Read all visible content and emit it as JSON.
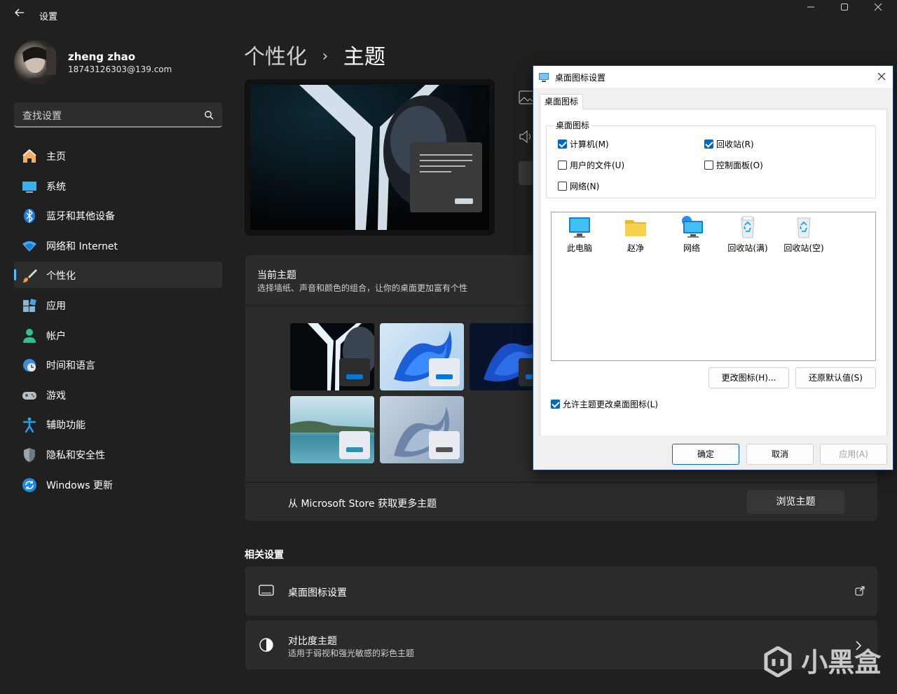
{
  "window": {
    "title": "设置",
    "back_icon": "arrow-left-icon",
    "controls": [
      "minimize-icon",
      "maximize-icon",
      "close-icon"
    ]
  },
  "profile": {
    "name": "zheng zhao",
    "email": "18743126303@139.com"
  },
  "search": {
    "placeholder": "查找设置"
  },
  "sidebar": {
    "items": [
      {
        "label": "主页",
        "icon": "home-icon"
      },
      {
        "label": "系统",
        "icon": "monitor-icon"
      },
      {
        "label": "蓝牙和其他设备",
        "icon": "bluetooth-icon"
      },
      {
        "label": "网络和 Internet",
        "icon": "wifi-icon"
      },
      {
        "label": "个性化",
        "icon": "paintbrush-icon",
        "active": true
      },
      {
        "label": "应用",
        "icon": "apps-icon"
      },
      {
        "label": "帐户",
        "icon": "user-icon"
      },
      {
        "label": "时间和语言",
        "icon": "clock-globe-icon"
      },
      {
        "label": "游戏",
        "icon": "gamepad-icon"
      },
      {
        "label": "辅助功能",
        "icon": "accessibility-icon"
      },
      {
        "label": "隐私和安全性",
        "icon": "shield-icon"
      },
      {
        "label": "Windows 更新",
        "icon": "update-icon"
      }
    ]
  },
  "breadcrumb": {
    "parent": "个性化",
    "separator": "›",
    "current": "主题"
  },
  "current_theme": {
    "title": "当前主题",
    "subtitle": "选择墙纸、声音和颜色的组合，让你的桌面更加富有个性"
  },
  "store": {
    "label": "从 Microsoft Store 获取更多主题",
    "button": "浏览主题"
  },
  "related": {
    "title": "相关设置",
    "items": [
      {
        "label": "桌面图标设置",
        "icon": "desktop-icon",
        "action_icon": "open-external-icon"
      },
      {
        "label": "对比度主题",
        "sub": "适用于弱视和强光敏感的彩色主题",
        "icon": "contrast-icon",
        "action_icon": "chevron-right-icon"
      }
    ]
  },
  "dialog": {
    "title": "桌面图标设置",
    "tab": "桌面图标",
    "group_label": "桌面图标",
    "checkboxes": [
      {
        "label": "计算机(M)",
        "checked": true
      },
      {
        "label": "回收站(R)",
        "checked": true
      },
      {
        "label": "用户的文件(U)",
        "checked": false
      },
      {
        "label": "控制面板(O)",
        "checked": false
      },
      {
        "label": "网络(N)",
        "checked": false
      }
    ],
    "icons": [
      {
        "label": "此电脑",
        "icon": "computer-icon"
      },
      {
        "label": "赵净",
        "icon": "folder-icon"
      },
      {
        "label": "网络",
        "icon": "network-icon"
      },
      {
        "label": "回收站(满)",
        "icon": "recycle-bin-full-icon"
      },
      {
        "label": "回收站(空)",
        "icon": "recycle-bin-empty-icon"
      }
    ],
    "change_icon_button": "更改图标(H)...",
    "restore_default_button": "还原默认值(S)",
    "allow_themes_label": "允许主题更改桌面图标(L)",
    "allow_themes_checked": true,
    "ok_button": "确定",
    "cancel_button": "取消",
    "apply_button": "应用(A)"
  },
  "watermark": "小黑盒",
  "colors": {
    "accent": "#4cc2ff",
    "dialog_accent": "#0067c0",
    "background": "#202020",
    "card": "#2b2b2b"
  }
}
